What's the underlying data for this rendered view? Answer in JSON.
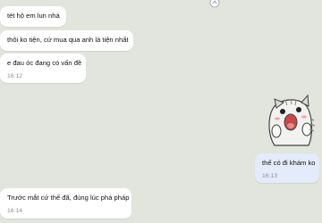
{
  "messages": [
    {
      "id": "m1",
      "direction": "received",
      "text": "tét hộ em lun nhá",
      "time": ""
    },
    {
      "id": "m2",
      "direction": "received",
      "text": "thôi ko tiện, cứ mua qua anh là tiện nhất",
      "time": ""
    },
    {
      "id": "m3",
      "direction": "received",
      "text": "e đau óc đang có vấn đề",
      "time": "16:12"
    },
    {
      "id": "m4",
      "direction": "sent",
      "text": "thế có đi khám ko",
      "time": "16:13"
    },
    {
      "id": "m5",
      "direction": "received",
      "text": "Trước mắt cứ thế đã, đúng lúc phá pháp",
      "time": "16:14"
    }
  ],
  "sticker": {
    "icon": "surprised-cat-sticker"
  },
  "top_icon": {
    "icon": "reaction-icon"
  },
  "colors": {
    "background": "#e2e4de",
    "received_bubble": "#ffffff",
    "sent_bubble": "#e4ecfb",
    "time_text": "#8a8f96"
  }
}
